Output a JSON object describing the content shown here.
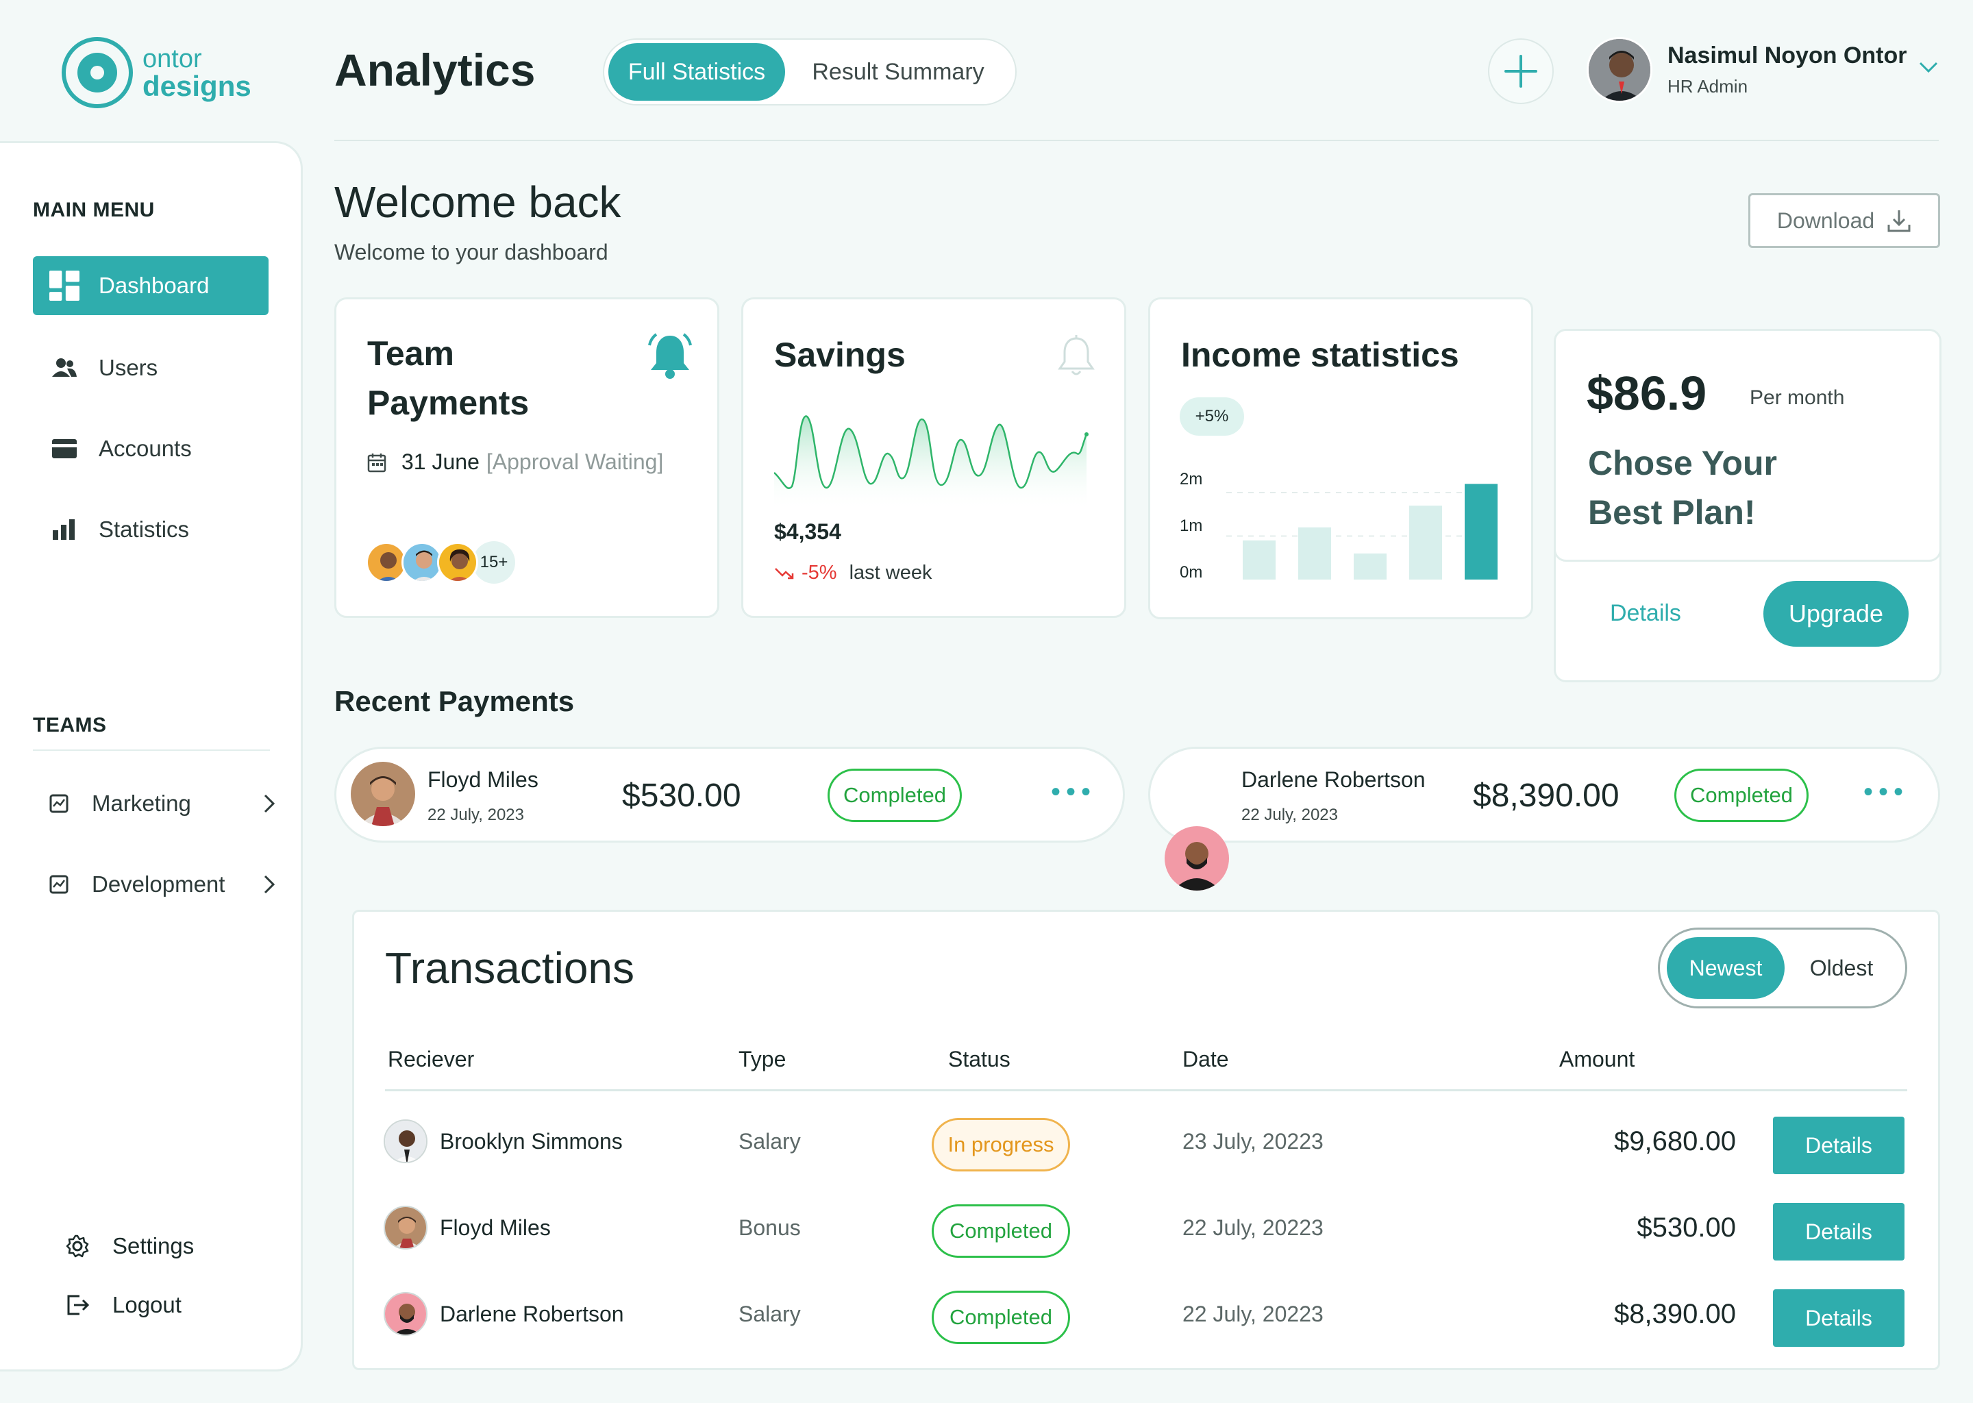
{
  "brand": {
    "line1": "ontor",
    "line2": "designs"
  },
  "header": {
    "title": "Analytics",
    "tabs": [
      {
        "label": "Full Statistics",
        "active": true
      },
      {
        "label": "Result Summary",
        "active": false
      }
    ],
    "user": {
      "name": "Nasimul Noyon Ontor",
      "role": "HR Admin"
    }
  },
  "sidebar": {
    "main_menu_label": "MAIN MENU",
    "items": [
      {
        "label": "Dashboard",
        "icon": "dashboard-icon",
        "active": true
      },
      {
        "label": "Users",
        "icon": "users-icon",
        "active": false
      },
      {
        "label": "Accounts",
        "icon": "card-icon",
        "active": false
      },
      {
        "label": "Statistics",
        "icon": "bar-chart-icon",
        "active": false
      }
    ],
    "teams_label": "TEAMS",
    "teams": [
      {
        "label": "Marketing"
      },
      {
        "label": "Development"
      }
    ],
    "settings_label": "Settings",
    "logout_label": "Logout"
  },
  "welcome": {
    "title": "Welcome back",
    "subtitle": "Welcome to your dashboard",
    "download_label": "Download"
  },
  "team_payments": {
    "title_line1": "Team",
    "title_line2": "Payments",
    "date": "31 June",
    "status": "[Approval Waiting]",
    "more_count": "15+"
  },
  "savings": {
    "title": "Savings",
    "amount": "$4,354",
    "change": "-5%",
    "period": "last week"
  },
  "income": {
    "title": "Income statistics",
    "change": "+5%",
    "y_labels": [
      "2m",
      "1m",
      "0m"
    ],
    "bar_values": [
      0.9,
      1.2,
      0.6,
      1.7,
      2.2
    ]
  },
  "plan": {
    "price": "$86.9",
    "period": "Per month",
    "headline_line1": "Chose Your",
    "headline_line2": "Best Plan!",
    "details_label": "Details",
    "upgrade_label": "Upgrade"
  },
  "recent_payments": {
    "title": "Recent Payments",
    "items": [
      {
        "name": "Floyd Miles",
        "date": "22 July, 2023",
        "amount": "$530.00",
        "status": "Completed"
      },
      {
        "name": "Darlene Robertson",
        "date": "22 July, 2023",
        "amount": "$8,390.00",
        "status": "Completed"
      }
    ]
  },
  "transactions": {
    "title": "Transactions",
    "sort": {
      "newest": "Newest",
      "oldest": "Oldest",
      "active": "newest"
    },
    "columns": [
      "Reciever",
      "Type",
      "Status",
      "Date",
      "Amount"
    ],
    "rows": [
      {
        "name": "Brooklyn Simmons",
        "type": "Salary",
        "status": "In progress",
        "date": "23 July, 20223",
        "amount": "$9,680.00",
        "action": "Details"
      },
      {
        "name": "Floyd Miles",
        "type": "Bonus",
        "status": "Completed",
        "date": "22 July, 20223",
        "amount": "$530.00",
        "action": "Details"
      },
      {
        "name": "Darlene Robertson",
        "type": "Salary",
        "status": "Completed",
        "date": "22 July, 20223",
        "amount": "$8,390.00",
        "action": "Details"
      }
    ]
  },
  "colors": {
    "accent": "#2fadad",
    "success": "#22a33e",
    "warning": "#e3961c",
    "danger": "#e53935"
  }
}
